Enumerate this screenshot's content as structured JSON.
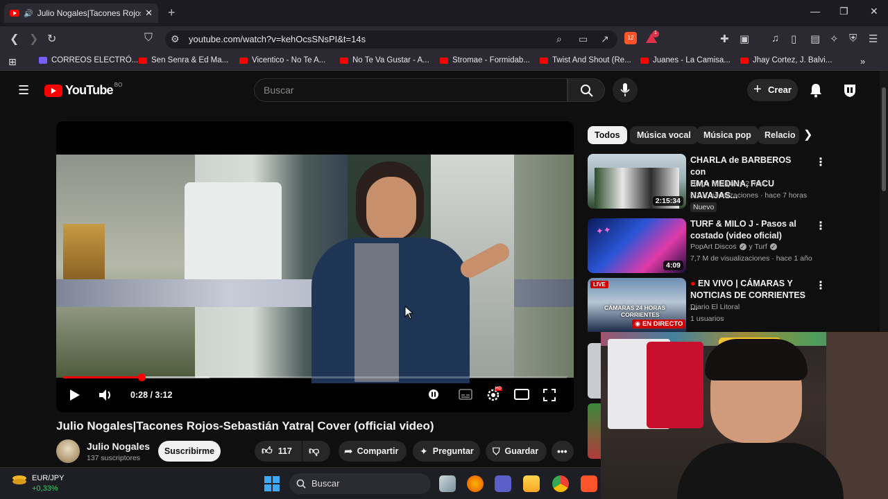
{
  "browser": {
    "tab_title": "Julio Nogales|Tacones Rojos",
    "url": "youtube.com/watch?v=kehOcsSNsPI&t=14s",
    "bookmarks": [
      "CORREOS ELECTRÓ...",
      "Sen Senra & Ed Ma...",
      "Vicentico - No Te A...",
      "No Te Va Gustar - A...",
      "Stromae - Formidab...",
      "Twist And Shout (Re...",
      "Juanes - La Camisa...",
      "Jhay Cortez, J. Balvi..."
    ],
    "ext_badge_1": "12",
    "ext_badge_2": "1"
  },
  "youtube": {
    "logo_text": "YouTube",
    "country": "BO",
    "search_placeholder": "Buscar",
    "create_label": "Crear",
    "player": {
      "time": "0:28 / 3:12",
      "progress_played_fraction": 0.156,
      "progress_buffered_fraction": 0.29,
      "settings_badge": "HD"
    },
    "video_title": "Julio Nogales|Tacones Rojos-Sebastián Yatra| Cover (official video)",
    "channel_name": "Julio Nogales",
    "subscribers": "137 suscriptores",
    "subscribe_label": "Suscribirme",
    "likes": "117",
    "share_label": "Compartir",
    "ask_label": "Preguntar",
    "save_label": "Guardar",
    "chips": [
      "Todos",
      "Música vocal",
      "Música pop",
      "Relacio"
    ],
    "recommended": [
      {
        "title_line1": "CHARLA de BARBEROS con",
        "title_line2": "EMA MEDINA, FACU NAVAJAS...",
        "channel": "Diego Navajas y 2 más",
        "stats": "5,1 K visualizaciones · hace 7 horas",
        "badge": "Nuevo",
        "duration": "2:15:34"
      },
      {
        "title_line1": "TURF & MILO J - Pasos al",
        "title_line2": "costado (video oficial)",
        "channel": "PopArt Discos",
        "channel_b": "y Turf",
        "stats": "7,7 M de visualizaciones · hace 1 año",
        "duration": "4:09"
      },
      {
        "title_line1": "EN VIVO | CÁMARAS Y",
        "title_line2": "NOTICIAS  DE CORRIENTES ...",
        "channel": "Diario El Litoral",
        "stats": "1 usuarios",
        "live_badge": "LIVE",
        "live_label": "EN DIRECTO",
        "thumb_text_1": "CÁMARAS 24 HORAS",
        "thumb_text_2": "CORRIENTES"
      }
    ]
  },
  "taskbar": {
    "ticker": "EUR/JPY",
    "ticker_change": "+0,33%",
    "search_label": "Buscar"
  },
  "colors": {
    "yt_red": "#ff0000",
    "bg": "#0f0f0f",
    "positive": "#3ccf6e"
  }
}
